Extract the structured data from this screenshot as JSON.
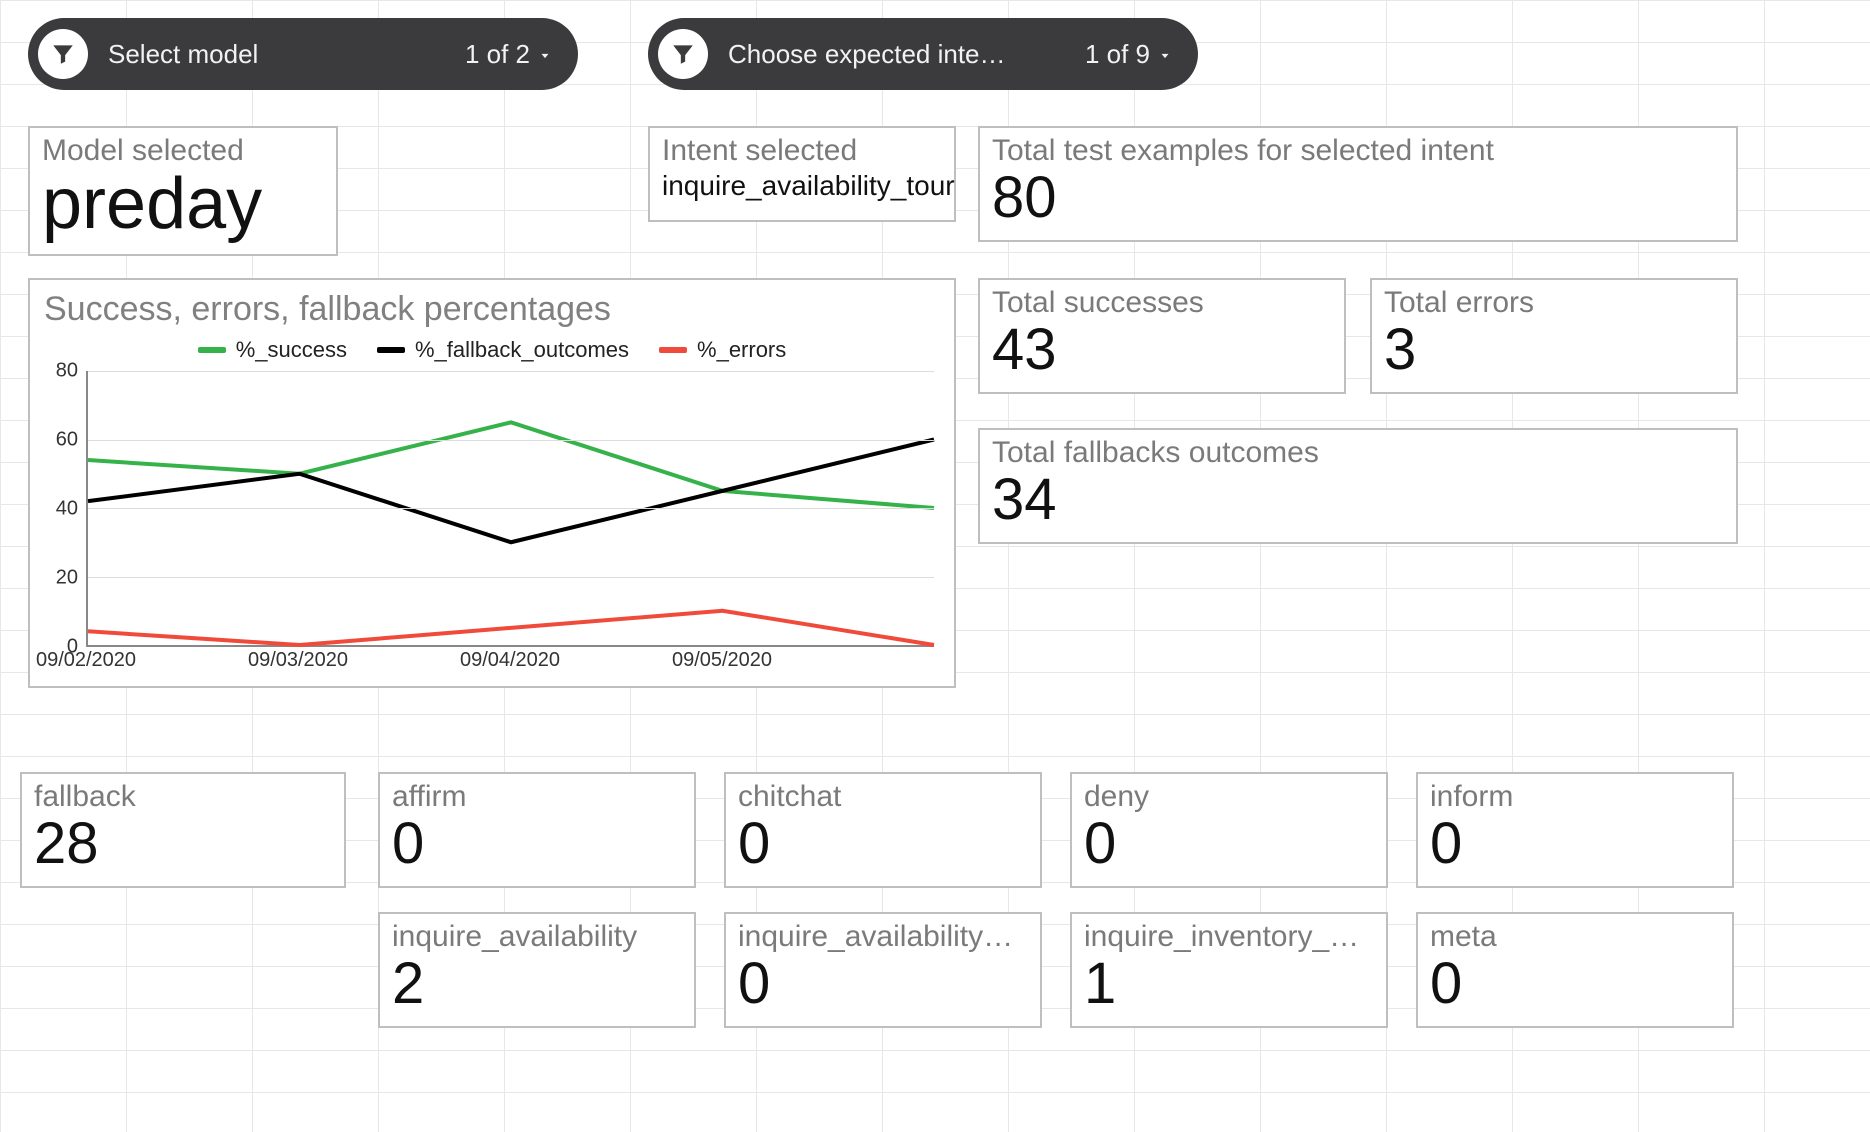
{
  "filters": {
    "model": {
      "label": "Select model",
      "count_label": "1 of 2"
    },
    "intent": {
      "label": "Choose expected inte…",
      "count_label": "1 of 9"
    }
  },
  "cards": {
    "model_selected": {
      "title": "Model selected",
      "value": "preday"
    },
    "intent_selected": {
      "title": "Intent selected",
      "value": "inquire_availability_tour"
    },
    "total_examples": {
      "title": "Total test examples for selected intent",
      "value": "80"
    },
    "total_successes": {
      "title": "Total successes",
      "value": "43"
    },
    "total_errors": {
      "title": "Total errors",
      "value": "3"
    },
    "total_fallbacks": {
      "title": "Total fallbacks outcomes",
      "value": "34"
    }
  },
  "bottom_row1": [
    {
      "title": "fallback",
      "value": "28"
    },
    {
      "title": "affirm",
      "value": "0"
    },
    {
      "title": "chitchat",
      "value": "0"
    },
    {
      "title": "deny",
      "value": "0"
    },
    {
      "title": "inform",
      "value": "0"
    }
  ],
  "bottom_row2": [
    {
      "title": "inquire_availability",
      "value": "2"
    },
    {
      "title": "inquire_availability_tour",
      "value": "0"
    },
    {
      "title": "inquire_inventory_avail…",
      "value": "1"
    },
    {
      "title": "meta",
      "value": "0"
    }
  ],
  "chart_data": {
    "type": "line",
    "title": "Success, errors, fallback percentages",
    "xlabel": "",
    "ylabel": "",
    "ylim": [
      0,
      80
    ],
    "y_ticks": [
      0,
      20,
      40,
      60,
      80
    ],
    "categories": [
      "09/02/2020",
      "09/03/2020",
      "09/04/2020",
      "09/05/2020",
      ""
    ],
    "series": [
      {
        "name": "%_success",
        "color": "#36b24a",
        "values": [
          54,
          50,
          65,
          45,
          40
        ]
      },
      {
        "name": "%_fallback_outcomes",
        "color": "#000000",
        "values": [
          42,
          50,
          30,
          45,
          60
        ]
      },
      {
        "name": "%_errors",
        "color": "#f04b3a",
        "values": [
          4,
          0,
          5,
          10,
          0
        ]
      }
    ]
  },
  "colors": {
    "pill_bg": "#3b3b3d"
  }
}
